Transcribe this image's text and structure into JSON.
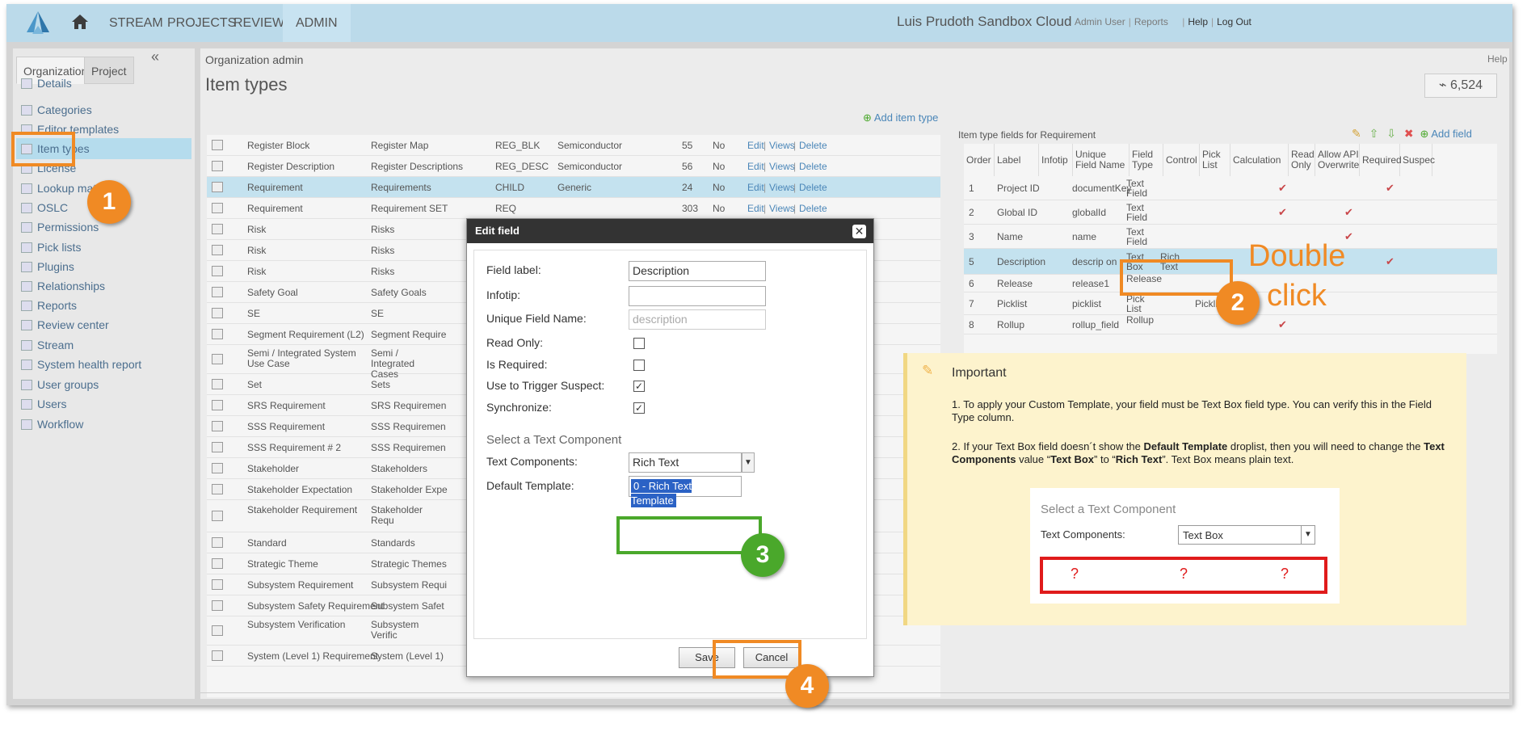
{
  "nav": {
    "items": [
      "STREAM",
      "PROJECTS",
      "REVIEWS",
      "ADMIN"
    ]
  },
  "header": {
    "org": "Luis Prudoth Sandbox Cloud",
    "admin_user": "Admin User",
    "reports": "Reports",
    "help": "Help",
    "logout": "Log Out"
  },
  "sidebar": {
    "tabs": [
      "Organization",
      "Project"
    ],
    "collapse": "«",
    "items": [
      "Details",
      "Categories",
      "Editor templates",
      "Item types",
      "License",
      "Lookup matrices",
      "OSLC",
      "Permissions",
      "Pick lists",
      "Plugins",
      "Relationships",
      "Reports",
      "Review center",
      "Stream",
      "System health report",
      "User groups",
      "Users",
      "Workflow"
    ]
  },
  "main": {
    "breadcrumb": "Organization admin",
    "title": "Item types",
    "help": "Help",
    "count": "6,524",
    "add_item_type": "Add item type"
  },
  "item_types": [
    {
      "name": "Register Block",
      "plural": "Register Map",
      "key": "REG_BLK",
      "category": "Semiconductor",
      "id": "55",
      "flag": "No"
    },
    {
      "name": "Register Description",
      "plural": "Register Descriptions",
      "key": "REG_DESC",
      "category": "Semiconductor",
      "id": "56",
      "flag": "No"
    },
    {
      "name": "Requirement",
      "plural": "Requirements",
      "key": "CHILD",
      "category": "Generic",
      "id": "24",
      "flag": "No"
    },
    {
      "name": "Requirement",
      "plural": "Requirement SET",
      "key": "REQ",
      "category": "",
      "id": "303",
      "flag": "No"
    },
    {
      "name": "Risk",
      "plural": "Risks"
    },
    {
      "name": "Risk",
      "plural": "Risks"
    },
    {
      "name": "Risk",
      "plural": "Risks"
    },
    {
      "name": "Safety Goal",
      "plural": "Safety Goals"
    },
    {
      "name": "SE",
      "plural": "SE"
    },
    {
      "name": "Segment Requirement (L2)",
      "plural": "Segment Require"
    },
    {
      "name": "Semi / Integrated System Use Case",
      "plural": "Semi / Integrated Cases"
    },
    {
      "name": "Set",
      "plural": "Sets"
    },
    {
      "name": "SRS Requirement",
      "plural": "SRS Requiremen"
    },
    {
      "name": "SSS Requirement",
      "plural": "SSS Requiremen"
    },
    {
      "name": "SSS Requirement # 2",
      "plural": "SSS Requiremen"
    },
    {
      "name": "Stakeholder",
      "plural": "Stakeholders"
    },
    {
      "name": "Stakeholder Expectation",
      "plural": "Stakeholder Expe"
    },
    {
      "name": "Stakeholder Requirement",
      "plural": "Stakeholder Requ"
    },
    {
      "name": "Standard",
      "plural": "Standards"
    },
    {
      "name": "Strategic Theme",
      "plural": "Strategic Themes"
    },
    {
      "name": "Subsystem Requirement",
      "plural": "Subsystem Requi"
    },
    {
      "name": "Subsystem Safety Requirement",
      "plural": "Subsystem Safet"
    },
    {
      "name": "Subsystem Verification",
      "plural": "Subsystem Verific"
    },
    {
      "name": "System (Level 1) Requirement",
      "plural": "System (Level 1)"
    }
  ],
  "row_actions": {
    "edit": "Edit",
    "views": "Views",
    "delete": "Delete",
    "views_cut": "iews"
  },
  "fields_panel": {
    "title": "Item type fields for Requirement",
    "add_field": "Add field",
    "headers": [
      "Order",
      "Label",
      "Infotip",
      "Unique Field Name",
      "Field Type",
      "Control",
      "Pick List",
      "Calculation",
      "Read Only",
      "Allow API Overwrite",
      "Required",
      "Suspec"
    ],
    "rows": [
      {
        "order": "1",
        "label": "Project ID",
        "ufn": "documentKey",
        "type": "Text Field",
        "control": "",
        "pick": "",
        "ro": true,
        "req": false,
        "sus": true
      },
      {
        "order": "2",
        "label": "Global ID",
        "ufn": "globalId",
        "type": "Text Field",
        "control": "",
        "pick": "",
        "ro": true,
        "req": true,
        "sus": false
      },
      {
        "order": "3",
        "label": "Name",
        "ufn": "name",
        "type": "Text Field",
        "control": "",
        "pick": "",
        "ro": false,
        "req": true,
        "sus": false
      },
      {
        "order": "5",
        "label": "Description",
        "ufn": "descrip on",
        "type": "Text Box",
        "control": "Rich Text",
        "pick": "",
        "ro": false,
        "req": false,
        "sus": true
      },
      {
        "order": "6",
        "label": "Release",
        "ufn": "release1",
        "type": "Release",
        "control": "",
        "pick": "",
        "ro": false,
        "req": false,
        "sus": false
      },
      {
        "order": "7",
        "label": "Picklist",
        "ufn": "picklist",
        "type": "Pick List",
        "control": "",
        "pick": "Picklist",
        "ro": false,
        "req": false,
        "sus": false
      },
      {
        "order": "8",
        "label": "Rollup",
        "ufn": "rollup_field",
        "type": "Rollup",
        "control": "",
        "pick": "",
        "ro": true,
        "req": false,
        "sus": false
      }
    ]
  },
  "dialog": {
    "title": "Edit field",
    "labels": {
      "field_label": "Field label:",
      "infotip": "Infotip:",
      "ufn": "Unique Field Name:",
      "read_only": "Read Only:",
      "is_required": "Is Required:",
      "trigger": "Use to Trigger Suspect:",
      "sync": "Synchronize:"
    },
    "values": {
      "field_label": "Description",
      "infotip": "",
      "ufn_placeholder": "description"
    },
    "checks": {
      "read_only": false,
      "is_required": false,
      "trigger": true,
      "sync": true
    },
    "section": "Select a Text Component",
    "text_components_label": "Text Components:",
    "text_components_value": "Rich Text",
    "default_template_label": "Default Template:",
    "default_template_value": "0 - Rich Text Template",
    "save": "Save",
    "cancel": "Cancel"
  },
  "note": {
    "title": "Important",
    "p1": "1. To apply your Custom Template, your field must be Text Box field type. You can verify this in the Field Type column.",
    "p2a": "2. If your Text Box field doesn´t show the ",
    "p2b": "Default Template",
    "p2c": " droplist, then you will need to change the ",
    "p2d": "Text Components",
    "p2e": " value “",
    "p2f": "Text Box",
    "p2g": "” to “",
    "p2h": "Rich Text",
    "p2i": "”. Text Box means plain text.",
    "inset_section": "Select a Text Component",
    "inset_label": "Text Components:",
    "inset_value": "Text Box",
    "q": "?"
  },
  "annotations": {
    "b1": "1",
    "b2": "2",
    "b3": "3",
    "b4": "4",
    "callout_line1": "Double",
    "callout_line2": "click",
    "orange": "#f08a24",
    "green": "#4aa82b",
    "red": "#e01b1b"
  }
}
